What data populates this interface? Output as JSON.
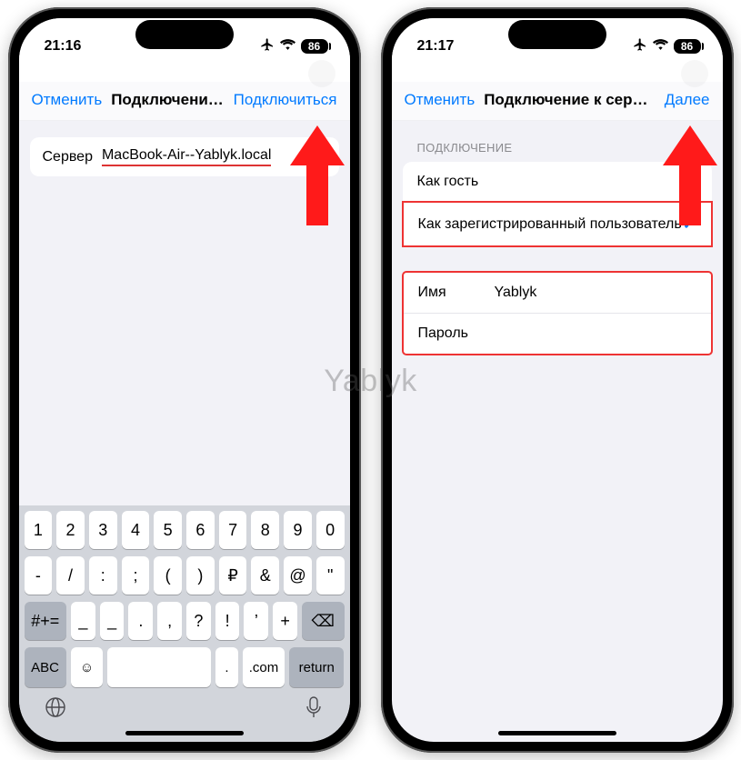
{
  "watermark": "Yablyk",
  "left": {
    "status": {
      "time": "21:16",
      "battery": "86"
    },
    "nav": {
      "cancel": "Отменить",
      "title": "Подключение к се...",
      "action": "Подключиться"
    },
    "server": {
      "label": "Сервер",
      "value": "MacBook-Air--Yablyk.local"
    },
    "keyboard": {
      "row1": [
        "1",
        "2",
        "3",
        "4",
        "5",
        "6",
        "7",
        "8",
        "9",
        "0"
      ],
      "row2": [
        "-",
        "/",
        ":",
        ";",
        "(",
        ")",
        "₽",
        "&",
        "@",
        "\""
      ],
      "sym": "#+=",
      "row3": [
        "_",
        "_",
        ".",
        ",",
        "?",
        "!",
        "’",
        "+"
      ],
      "backspace": "⌫",
      "abc": "ABC",
      "emoji": "☺",
      "dotcom": ".com",
      "return": "return",
      "dot": "."
    }
  },
  "right": {
    "status": {
      "time": "21:17",
      "battery": "86"
    },
    "nav": {
      "cancel": "Отменить",
      "title": "Подключение к серверу",
      "action": "Далее"
    },
    "section_header": "ПОДКЛЮЧЕНИЕ",
    "options": {
      "guest": "Как гость",
      "registered": "Как зарегистрированный пользователь"
    },
    "fields": {
      "name_label": "Имя",
      "name_value": "Yablyk",
      "password_label": "Пароль",
      "password_value": ""
    }
  }
}
